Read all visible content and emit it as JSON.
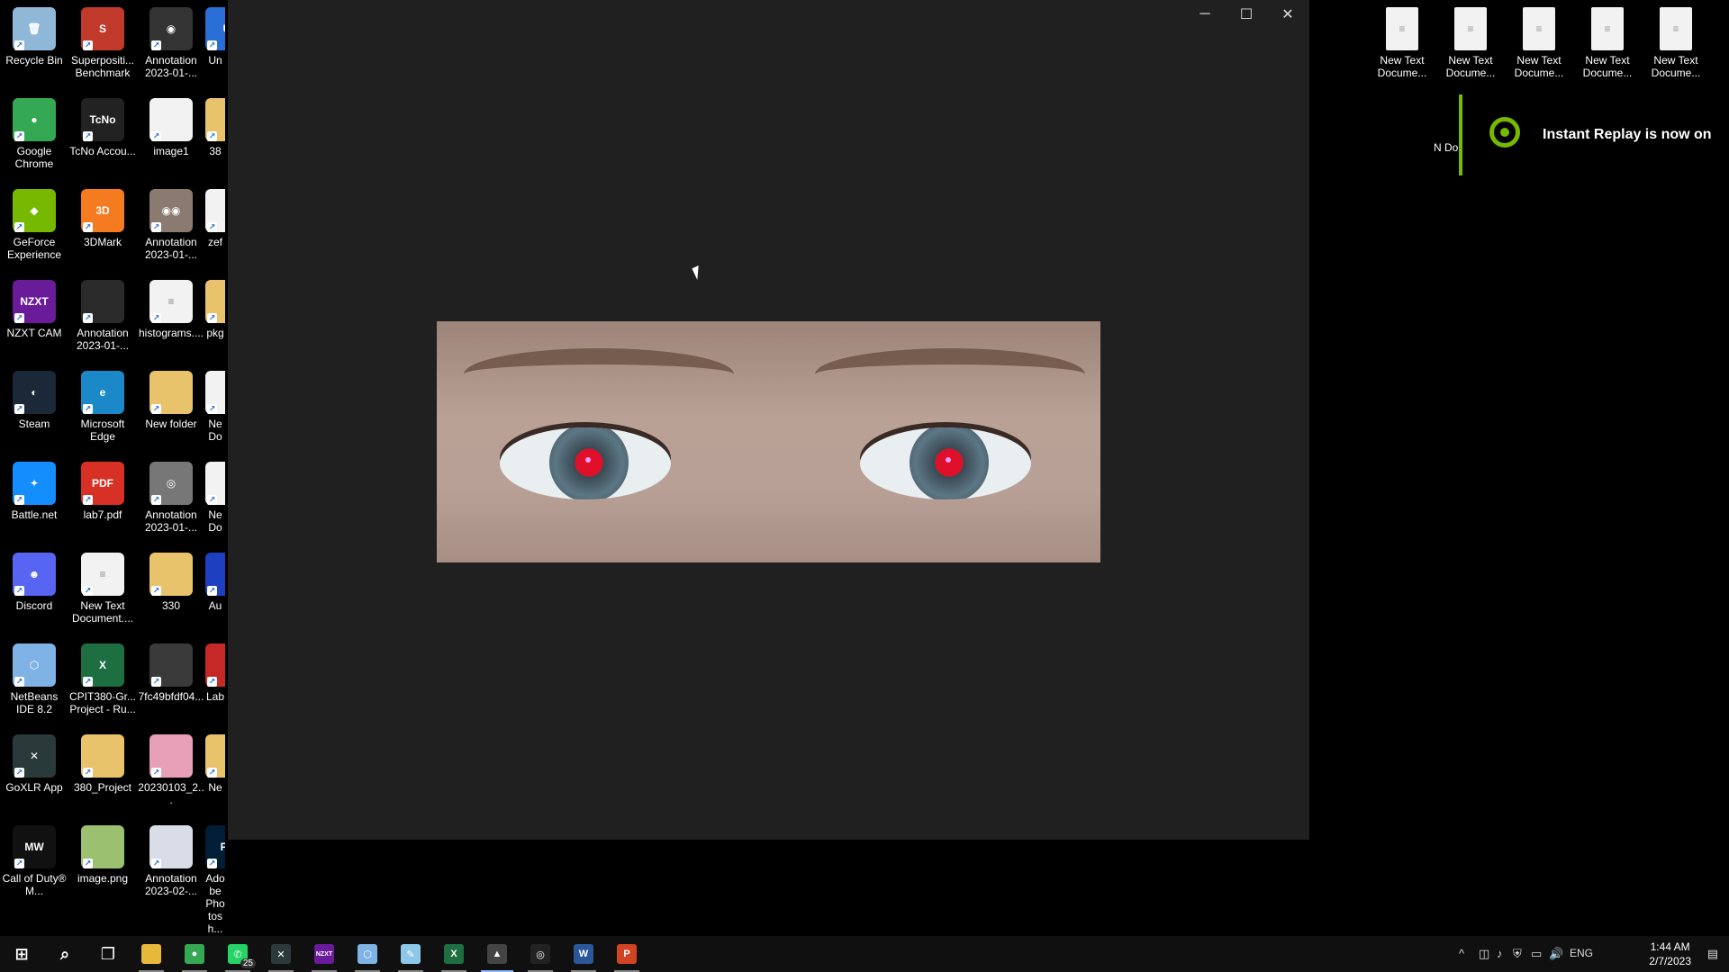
{
  "desktop": {
    "left_icons": [
      {
        "label": "Recycle Bin",
        "icon": "recycle-bin-icon",
        "color": "#8fb8d8",
        "glyph": "🗑"
      },
      {
        "label": "Superpositi... Benchmark",
        "icon": "superposition-icon",
        "color": "#c0392b",
        "glyph": "S"
      },
      {
        "label": "Annotation 2023-01-...",
        "icon": "image-file-icon",
        "color": "#333333",
        "glyph": "◉"
      },
      {
        "label": "Un",
        "icon": "app-icon",
        "color": "#2a6ed8",
        "glyph": "U"
      },
      {
        "label": "Google Chrome",
        "icon": "chrome-icon",
        "color": "#34a853",
        "glyph": "●"
      },
      {
        "label": "TcNo Accou...",
        "icon": "tcno-icon",
        "color": "#222222",
        "glyph": "TcNo"
      },
      {
        "label": "image1",
        "icon": "file-icon",
        "color": "#f2f2f2",
        "glyph": ""
      },
      {
        "label": "38",
        "icon": "folder-icon",
        "color": "#e8c36b",
        "glyph": ""
      },
      {
        "label": "GeForce Experience",
        "icon": "geforce-icon",
        "color": "#76b900",
        "glyph": "◆"
      },
      {
        "label": "3DMark",
        "icon": "3dmark-icon",
        "color": "#f47b20",
        "glyph": "3D"
      },
      {
        "label": "Annotation 2023-01-...",
        "icon": "image-file-icon",
        "color": "#8a7a70",
        "glyph": "◉◉"
      },
      {
        "label": "zef",
        "icon": "file-icon",
        "color": "#f2f2f2",
        "glyph": ""
      },
      {
        "label": "NZXT CAM",
        "icon": "nzxt-cam-icon",
        "color": "#6a1b9a",
        "glyph": "NZXT"
      },
      {
        "label": "Annotation 2023-01-...",
        "icon": "image-file-icon",
        "color": "#2b2b2b",
        "glyph": ""
      },
      {
        "label": "histograms....",
        "icon": "text-file-icon",
        "color": "#f2f2f2",
        "glyph": "≡"
      },
      {
        "label": "pkg",
        "icon": "folder-icon",
        "color": "#e8c36b",
        "glyph": ""
      },
      {
        "label": "Steam",
        "icon": "steam-icon",
        "color": "#1b2838",
        "glyph": "◐"
      },
      {
        "label": "Microsoft Edge",
        "icon": "edge-icon",
        "color": "#1b88c7",
        "glyph": "e"
      },
      {
        "label": "New folder",
        "icon": "folder-icon",
        "color": "#e8c36b",
        "glyph": ""
      },
      {
        "label": "Ne Do",
        "icon": "file-icon",
        "color": "#f2f2f2",
        "glyph": ""
      },
      {
        "label": "Battle.net",
        "icon": "battlenet-icon",
        "color": "#148eff",
        "glyph": "✦"
      },
      {
        "label": "lab7.pdf",
        "icon": "pdf-icon",
        "color": "#d93025",
        "glyph": "PDF"
      },
      {
        "label": "Annotation 2023-01-...",
        "icon": "image-file-icon",
        "color": "#777777",
        "glyph": "◎"
      },
      {
        "label": "Ne Do",
        "icon": "file-icon",
        "color": "#f2f2f2",
        "glyph": ""
      },
      {
        "label": "Discord",
        "icon": "discord-icon",
        "color": "#5865f2",
        "glyph": "☻"
      },
      {
        "label": "New Text Document....",
        "icon": "text-file-icon",
        "color": "#f2f2f2",
        "glyph": "≡"
      },
      {
        "label": "330",
        "icon": "folder-icon",
        "color": "#e8c36b",
        "glyph": ""
      },
      {
        "label": "Au",
        "icon": "app-icon",
        "color": "#1e3fbf",
        "glyph": ""
      },
      {
        "label": "NetBeans IDE 8.2",
        "icon": "netbeans-icon",
        "color": "#7fb2e5",
        "glyph": "⬡"
      },
      {
        "label": "CPIT380-Gr... Project - Ru...",
        "icon": "excel-icon",
        "color": "#1d6f42",
        "glyph": "X"
      },
      {
        "label": "7fc49bfdf04...",
        "icon": "image-file-icon",
        "color": "#3a3a3a",
        "glyph": ""
      },
      {
        "label": "Lab",
        "icon": "app-icon",
        "color": "#c62828",
        "glyph": ""
      },
      {
        "label": "GoXLR App",
        "icon": "goxlr-icon",
        "color": "#2a3a3a",
        "glyph": "✕"
      },
      {
        "label": "380_Project",
        "icon": "folder-icon",
        "color": "#e8c36b",
        "glyph": ""
      },
      {
        "label": "20230103_2...",
        "icon": "image-file-icon",
        "color": "#e7a0b8",
        "glyph": ""
      },
      {
        "label": "Ne",
        "icon": "folder-icon",
        "color": "#e8c36b",
        "glyph": ""
      },
      {
        "label": "Call of Duty® M...",
        "icon": "cod-icon",
        "color": "#111111",
        "glyph": "MW"
      },
      {
        "label": "image.png",
        "icon": "image-file-icon",
        "color": "#9ac070",
        "glyph": ""
      },
      {
        "label": "Annotation 2023-02-...",
        "icon": "image-file-icon",
        "color": "#d8dde8",
        "glyph": ""
      },
      {
        "label": "Adobe Photosh...",
        "icon": "photoshop-icon",
        "color": "#001e36",
        "glyph": "Ps"
      }
    ],
    "right_icons": [
      {
        "label": "New Text Docume...",
        "icon": "text-file-icon"
      },
      {
        "label": "New Text Docume...",
        "icon": "text-file-icon"
      },
      {
        "label": "New Text Docume...",
        "icon": "text-file-icon"
      },
      {
        "label": "New Text Docume...",
        "icon": "text-file-icon"
      },
      {
        "label": "New Text Docume...",
        "icon": "text-file-icon"
      }
    ],
    "partial_right": {
      "label": "N Do"
    }
  },
  "viewer": {
    "minimize": "─",
    "maximize": "☐",
    "close": "✕"
  },
  "notification": {
    "text": "Instant Replay is now on",
    "accent": "#76b900"
  },
  "taskbar": {
    "items": [
      {
        "name": "start-button",
        "glyph": "⊞",
        "color": "#ffffff"
      },
      {
        "name": "search-button",
        "glyph": "⌕",
        "color": "#ffffff"
      },
      {
        "name": "task-view-button",
        "glyph": "❐",
        "color": "#ffffff"
      },
      {
        "name": "file-explorer",
        "glyph": "",
        "color": "#e8b83a",
        "state": "open"
      },
      {
        "name": "chrome",
        "glyph": "●",
        "color": "#34a853",
        "state": "open"
      },
      {
        "name": "whatsapp",
        "glyph": "✆",
        "color": "#25d366",
        "state": "open",
        "badge": "25"
      },
      {
        "name": "goxlr",
        "glyph": "✕",
        "color": "#2a3a3a",
        "state": "open"
      },
      {
        "name": "nzxt-cam",
        "glyph": "NZXT",
        "color": "#6a1b9a",
        "state": "open"
      },
      {
        "name": "netbeans",
        "glyph": "⬡",
        "color": "#7fb2e5",
        "state": "open"
      },
      {
        "name": "notepad",
        "glyph": "✎",
        "color": "#8ec8e8",
        "state": "open"
      },
      {
        "name": "excel",
        "glyph": "X",
        "color": "#1d6f42",
        "state": "open"
      },
      {
        "name": "photos",
        "glyph": "▲",
        "color": "#444444",
        "state": "active"
      },
      {
        "name": "xbox",
        "glyph": "◎",
        "color": "#222222",
        "state": "open"
      },
      {
        "name": "word",
        "glyph": "W",
        "color": "#2b579a",
        "state": "open"
      },
      {
        "name": "powerpoint",
        "glyph": "P",
        "color": "#d04423",
        "state": "open"
      }
    ],
    "tray": {
      "chevron": "^",
      "language": "ENG",
      "time": "1:44 AM",
      "date": "2/7/2023"
    }
  }
}
